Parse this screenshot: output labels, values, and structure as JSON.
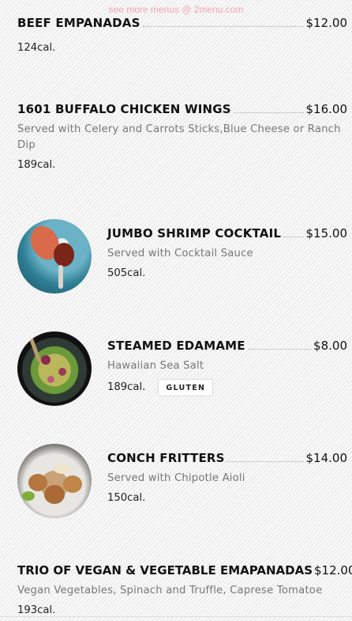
{
  "watermark": "see more menus @ 2menu.com",
  "items": [
    {
      "name": "BEEF EMPANADAS",
      "price": "$12.00",
      "description": "",
      "calories": "124cal."
    },
    {
      "name": "1601 BUFFALO CHICKEN WINGS",
      "price": "$16.00",
      "description": "Served with Celery and Carrots Sticks,Blue Cheese or Ranch Dip",
      "calories": "189cal."
    },
    {
      "name": "JUMBO SHRIMP COCKTAIL",
      "price": "$15.00",
      "description": "Served with Cocktail Sauce",
      "calories": "505cal.",
      "image": "shrimp-cocktail-photo"
    },
    {
      "name": "STEAMED EDAMAME",
      "price": "$8.00",
      "description": "Hawaiian Sea Salt",
      "calories": "189cal.",
      "badge": "GLUTEN",
      "image": "edamame-photo"
    },
    {
      "name": "CONCH FRITTERS",
      "price": "$14.00",
      "description": "Served with Chipotle Aioli",
      "calories": "150cal.",
      "image": "conch-fritters-photo"
    },
    {
      "name": "TRIO OF VEGAN & VEGETABLE EMAPANADAS",
      "price": "$12.00",
      "description": "Vegan Vegetables, Spinach and Truffle, Caprese Tomatoe",
      "calories": "193cal."
    }
  ]
}
